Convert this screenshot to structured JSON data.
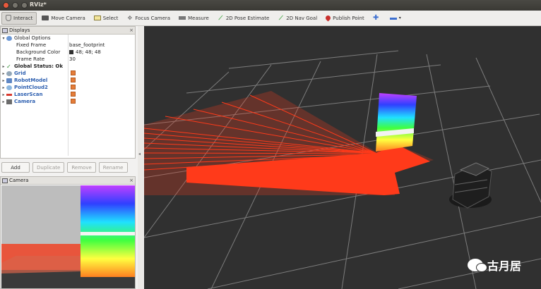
{
  "window": {
    "title": "RViz*"
  },
  "toolbar": {
    "tools": [
      {
        "label": "Interact",
        "icon": "hand-icon"
      },
      {
        "label": "Move Camera",
        "icon": "move-camera-icon"
      },
      {
        "label": "Select",
        "icon": "select-icon"
      },
      {
        "label": "Focus Camera",
        "icon": "focus-camera-icon"
      },
      {
        "label": "Measure",
        "icon": "measure-icon"
      },
      {
        "label": "2D Pose Estimate",
        "icon": "pose-estimate-icon"
      },
      {
        "label": "2D Nav Goal",
        "icon": "nav-goal-icon"
      },
      {
        "label": "Publish Point",
        "icon": "publish-point-icon"
      }
    ]
  },
  "displays": {
    "title": "Displays",
    "global_options": "Global Options",
    "fixed_frame": {
      "label": "Fixed Frame",
      "value": "base_footprint"
    },
    "background_color": {
      "label": "Background Color",
      "value": "48; 48; 48"
    },
    "frame_rate": {
      "label": "Frame Rate",
      "value": "30"
    },
    "global_status": "Global Status: Ok",
    "items": [
      "Grid",
      "RobotModel",
      "PointCloud2",
      "LaserScan",
      "Camera"
    ]
  },
  "buttons": {
    "add": "Add",
    "duplicate": "Duplicate",
    "remove": "Remove",
    "rename": "Rename"
  },
  "camera_panel": {
    "title": "Camera"
  },
  "watermark": "古月居",
  "colors": {
    "background": "#303030",
    "laser": "#ff3a1a",
    "accent": "#2d5fb0"
  }
}
